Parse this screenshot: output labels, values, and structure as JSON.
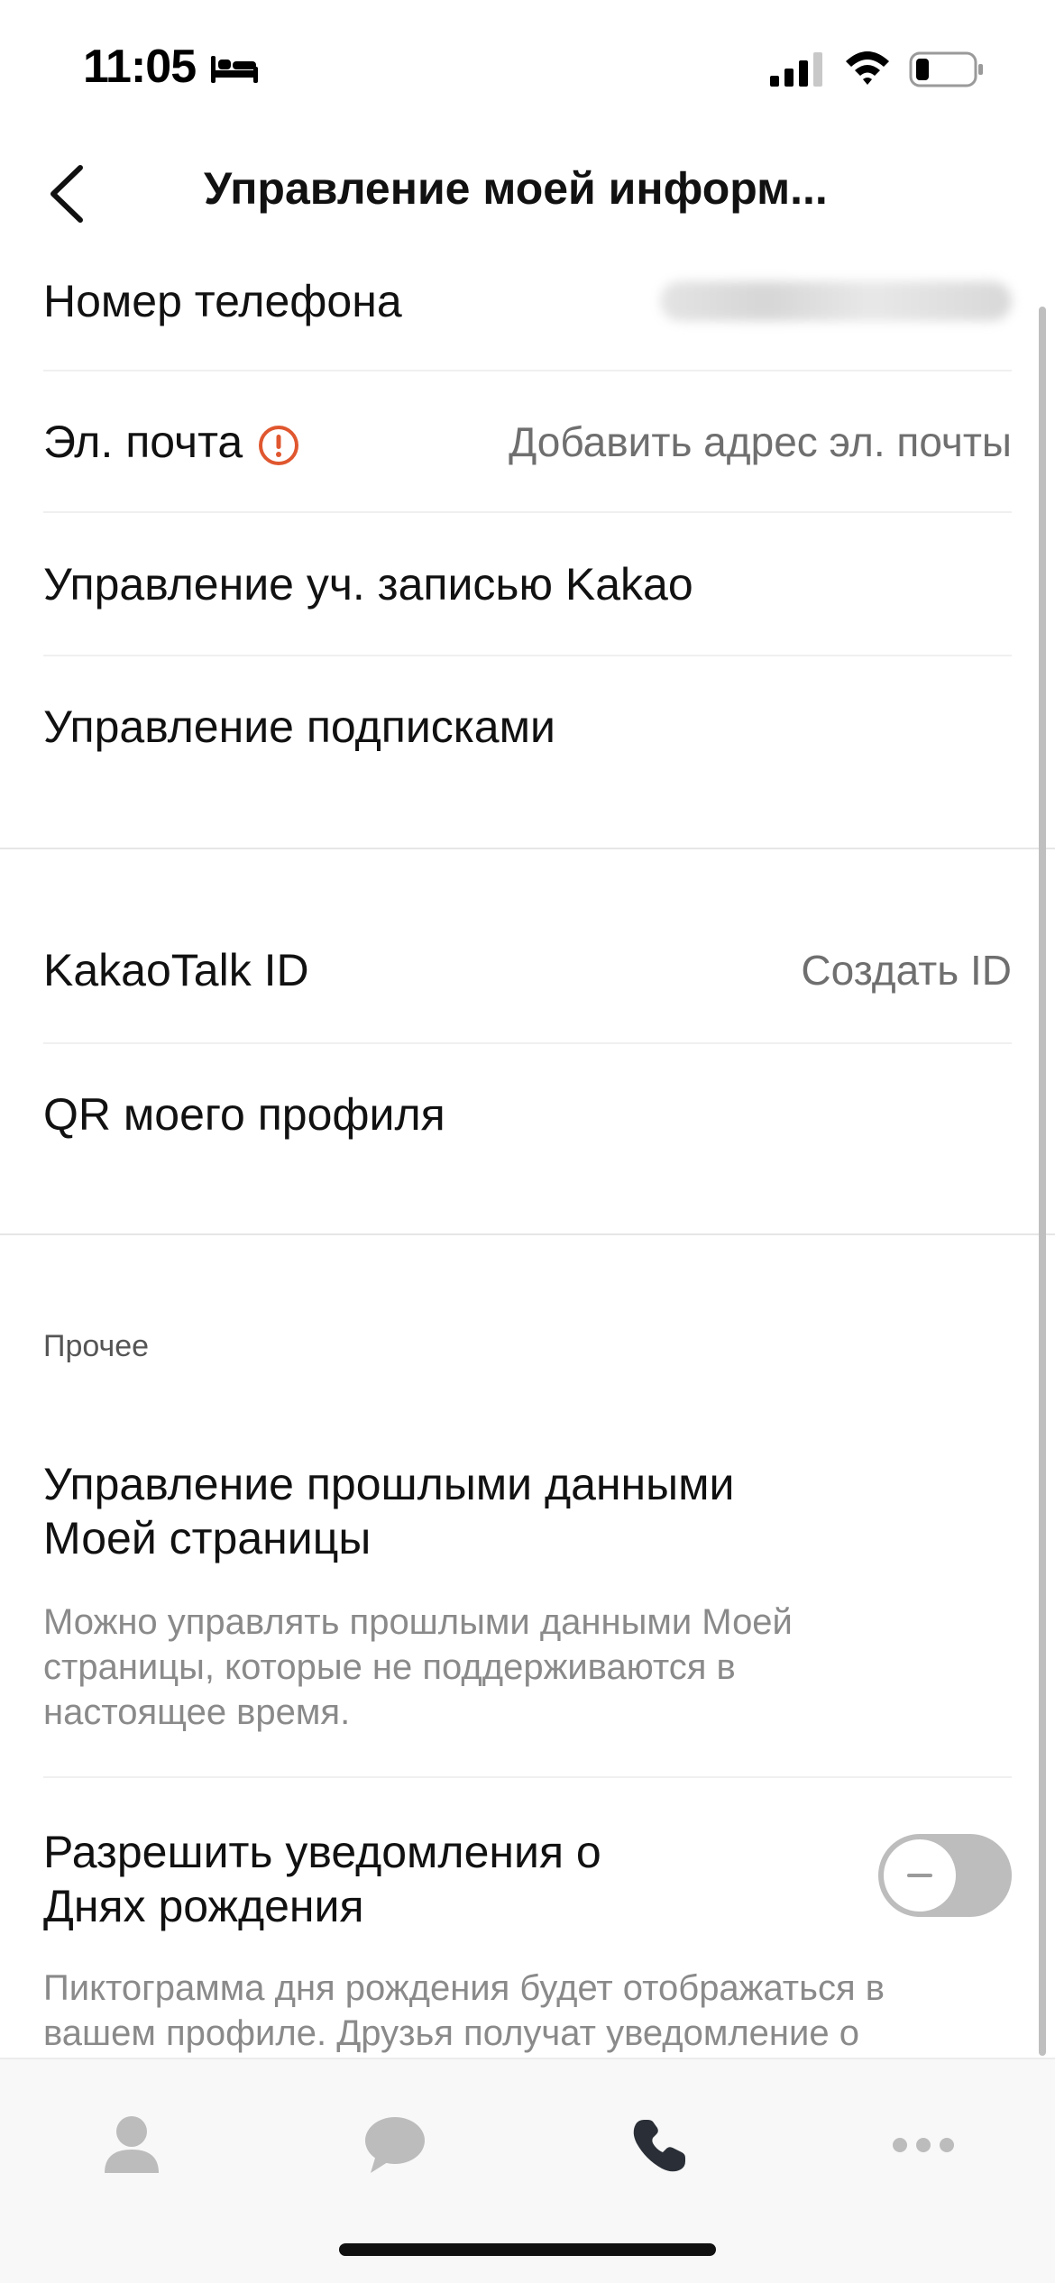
{
  "status_bar": {
    "time": "11:05"
  },
  "nav": {
    "title": "Управление моей информ..."
  },
  "account_section": {
    "phone_label": "Номер телефона",
    "email_label": "Эл. почта",
    "email_value": "Добавить адрес эл. почты",
    "kakao_account_label": "Управление уч. записью Kakao",
    "subscriptions_label": "Управление подписками"
  },
  "id_section": {
    "kakaotalk_id_label": "KakaoTalk ID",
    "kakaotalk_id_value": "Создать ID",
    "qr_label": "QR моего профиля"
  },
  "other_section": {
    "header": "Прочее",
    "past_data_title_line1": "Управление прошлыми данными",
    "past_data_title_line2": "Моей страницы",
    "past_data_desc_line1": "Можно управлять прошлыми данными Моей",
    "past_data_desc_line2": "страницы, которые не поддерживаются в",
    "past_data_desc_line3": "настоящее время.",
    "birthday_title_line1": "Разрешить уведомления о",
    "birthday_title_line2": "Днях рождения",
    "birthday_toggle_on": false,
    "birthday_desc_line1": "Пиктограмма дня рождения будет отображаться в",
    "birthday_desc_line2": "вашем профиле. Друзья получат уведомление о"
  },
  "tab_bar": {
    "tabs": [
      "friends-icon",
      "chats-icon",
      "calls-icon",
      "more-icon"
    ],
    "active_tab": "calls-icon"
  },
  "colors": {
    "warning": "#e0572f",
    "toggle_off": "#bdbdbd"
  }
}
